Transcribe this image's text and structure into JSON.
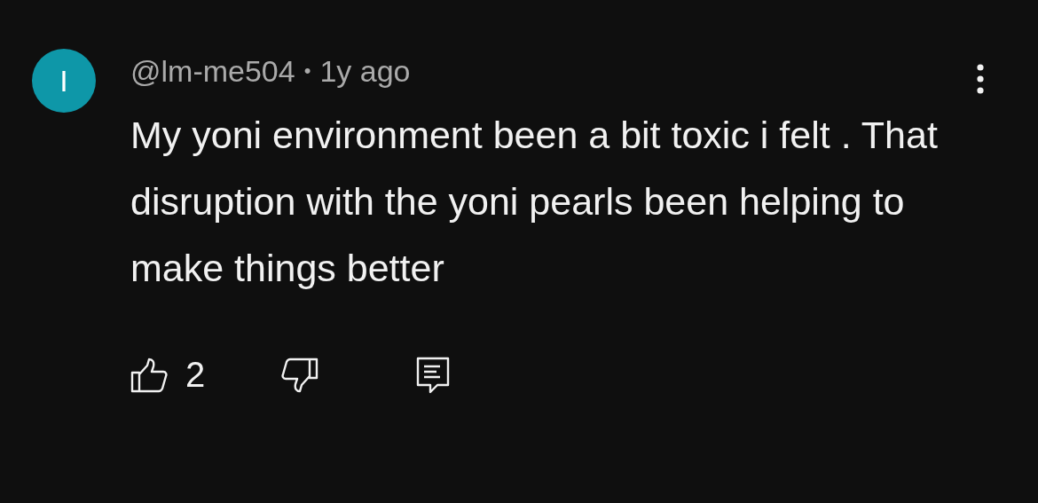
{
  "comment": {
    "avatar_letter": "I",
    "author": "@lm-me504",
    "separator": "•",
    "time": "1y ago",
    "text": "My yoni environment been a bit toxic i felt . That disruption with the yoni pearls been helping to make things better",
    "like_count": "2"
  }
}
